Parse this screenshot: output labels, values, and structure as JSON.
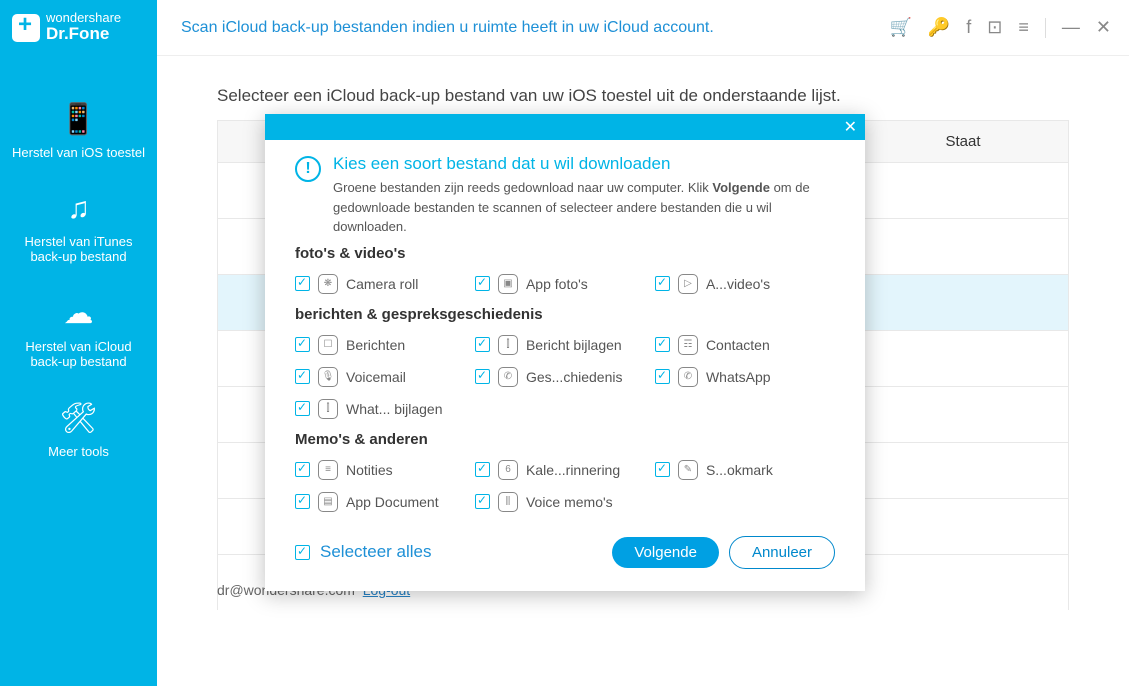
{
  "brand": {
    "line1": "wondershare",
    "line2": "Dr.Fone"
  },
  "tagline": "Scan iCloud back-up bestanden indien u ruimte heeft in uw iCloud account.",
  "sidebar": [
    {
      "icon": "📱",
      "label": "Herstel van iOS toestel"
    },
    {
      "icon": "♫",
      "label": "Herstel van iTunes back-up bestand"
    },
    {
      "icon": "☁",
      "label": "Herstel van iCloud back-up bestand"
    },
    {
      "icon": "🛠",
      "label": "Meer tools"
    }
  ],
  "heading": "Selecteer een iCloud back-up bestand van uw iOS toestel uit de onderstaande lijst.",
  "tableHeader": {
    "c2": "Staat"
  },
  "footer": {
    "email": "dr@wondershare.com",
    "logout": "Log-out"
  },
  "modal": {
    "title": "Kies een soort bestand dat u wil downloaden",
    "desc1": "Groene bestanden zijn reeds gedownload naar uw computer. Klik ",
    "bold": "Volgende",
    "desc2": " om de gedownloade bestanden te scannen of selecteer andere bestanden die u wil downloaden.",
    "sections": [
      {
        "title": "foto's & video's",
        "items": [
          {
            "label": "Camera roll",
            "icon": "❋"
          },
          {
            "label": "App foto's",
            "icon": "▣"
          },
          {
            "label": "A...video's",
            "icon": "▷"
          }
        ]
      },
      {
        "title": "berichten & gespreksgeschiedenis",
        "items": [
          {
            "label": "Berichten",
            "icon": "☐"
          },
          {
            "label": "Bericht bijlagen",
            "icon": "⫿"
          },
          {
            "label": "Contacten",
            "icon": "☶"
          },
          {
            "label": "Voicemail",
            "icon": "🎙"
          },
          {
            "label": "Ges...chiedenis",
            "icon": "✆"
          },
          {
            "label": "WhatsApp",
            "icon": "✆"
          },
          {
            "label": "What... bijlagen",
            "icon": "⫿"
          }
        ]
      },
      {
        "title": "Memo's & anderen",
        "items": [
          {
            "label": "Notities",
            "icon": "≡"
          },
          {
            "label": "Kale...rinnering",
            "icon": "6"
          },
          {
            "label": "S...okmark",
            "icon": "✎"
          },
          {
            "label": "App Document",
            "icon": "▤"
          },
          {
            "label": "Voice memo's",
            "icon": "⫼"
          }
        ]
      }
    ],
    "selectAll": "Selecteer alles",
    "next": "Volgende",
    "cancel": "Annuleer"
  }
}
